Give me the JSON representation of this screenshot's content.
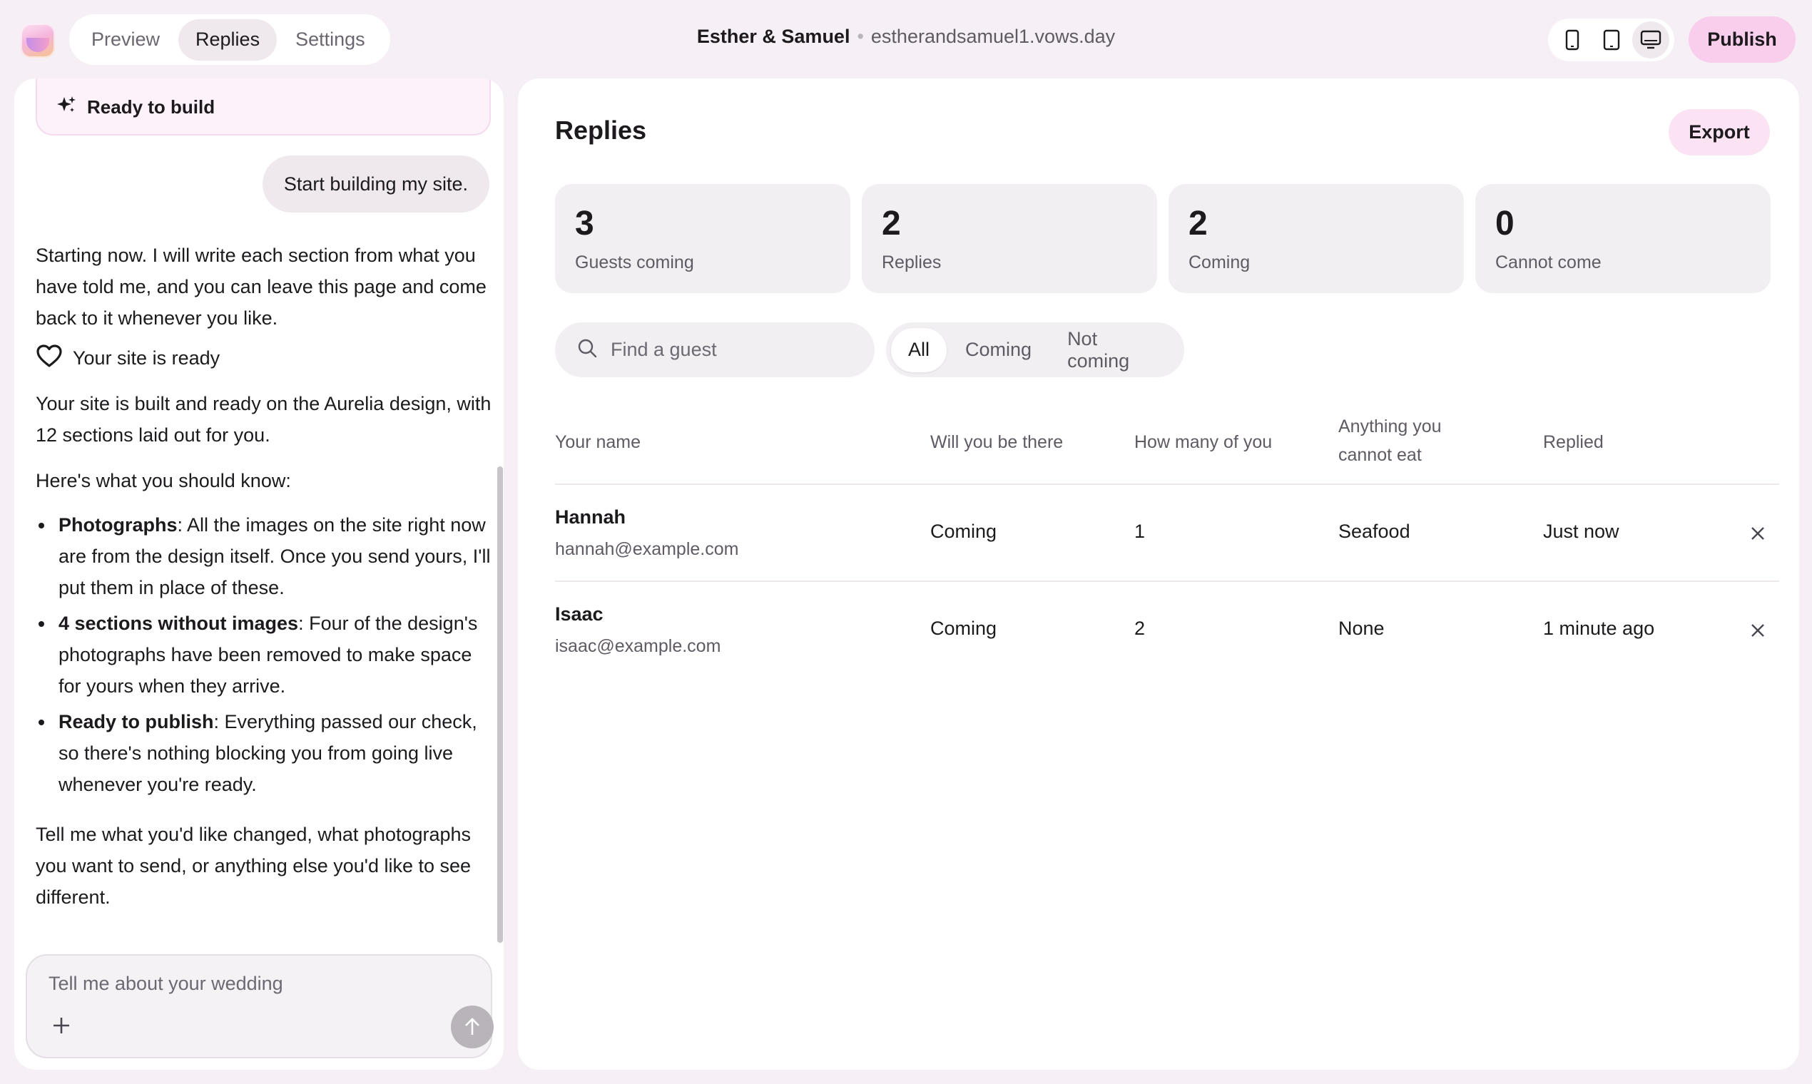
{
  "header": {
    "tabs": [
      {
        "label": "Preview",
        "active": false
      },
      {
        "label": "Replies",
        "active": true
      },
      {
        "label": "Settings",
        "active": false
      }
    ],
    "site_name": "Esther & Samuel",
    "separator": "•",
    "site_url": "estherandsamuel1.vows.day",
    "devices": [
      "phone-icon",
      "tablet-icon",
      "desktop-icon"
    ],
    "active_device": "desktop-icon",
    "publish_label": "Publish"
  },
  "chat": {
    "ready_card": "Ready to build",
    "user_message": "Start building my site.",
    "assistant_intro": "Starting now. I will write each section from what you have told me, and you can leave this page and come back to it whenever you like.",
    "status_line": "Your site is ready",
    "built_text": "Your site is built and ready on the Aurelia design, with 12 sections laid out for you.",
    "know_heading": "Here's what you should know:",
    "bullets": [
      {
        "title": "Photographs",
        "text": ": All the images on the site right now are from the design itself. Once you send yours, I'll put them in place of these."
      },
      {
        "title": "4 sections without images",
        "text": ": Four of the design's photographs have been removed to make space for yours when they arrive."
      },
      {
        "title": "Ready to publish",
        "text": ": Everything passed our check, so there's nothing blocking you from going live whenever you're ready."
      }
    ],
    "closing": "Tell me what you'd like changed, what photographs you want to send, or anything else you'd like to see different.",
    "composer_placeholder": "Tell me about your wedding"
  },
  "replies": {
    "title": "Replies",
    "export_label": "Export",
    "stats": [
      {
        "value": "3",
        "label": "Guests coming"
      },
      {
        "value": "2",
        "label": "Replies"
      },
      {
        "value": "2",
        "label": "Coming"
      },
      {
        "value": "0",
        "label": "Cannot come"
      }
    ],
    "search_placeholder": "Find a guest",
    "filters": [
      {
        "label": "All",
        "active": true
      },
      {
        "label": "Coming",
        "active": false
      },
      {
        "label": "Not coming",
        "active": false
      }
    ],
    "columns": [
      "Your name",
      "Will you be there",
      "How many of you",
      "Anything you cannot eat",
      "Replied"
    ],
    "rows": [
      {
        "name": "Hannah",
        "email": "hannah@example.com",
        "attending": "Coming",
        "count": "1",
        "diet": "Seafood",
        "replied": "Just now"
      },
      {
        "name": "Isaac",
        "email": "isaac@example.com",
        "attending": "Coming",
        "count": "2",
        "diet": "None",
        "replied": "1 minute ago"
      }
    ]
  },
  "colors": {
    "background": "#f6eff5",
    "accent_pink": "#f9cdec",
    "surface": "#ffffff",
    "muted_surface": "#f2eff2"
  }
}
